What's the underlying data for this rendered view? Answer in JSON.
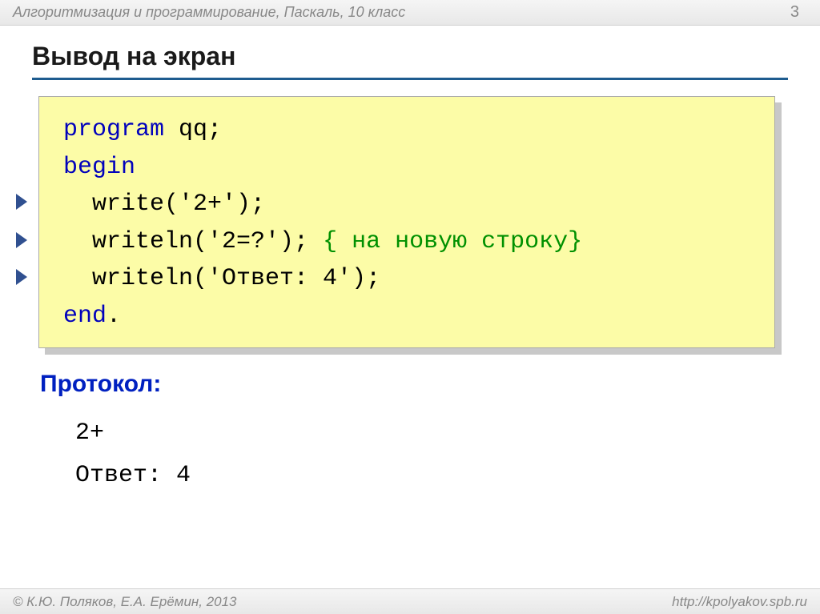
{
  "header": {
    "title": "Алгоритмизация и программирование, Паскаль, 10 класс",
    "page_number": "3"
  },
  "slide": {
    "title": "Вывод на экран"
  },
  "code": {
    "line1_keyword": "program",
    "line1_rest": " qq;",
    "line2_keyword": "begin",
    "line3_pre": "  write(",
    "line3_str": "'2+'",
    "line3_post": ");",
    "line4_pre": "  writeln(",
    "line4_str": "'2=?'",
    "line4_post": "); ",
    "line4_comment": "{ на новую строку}",
    "line5_pre": "  writeln(",
    "line5_str": "'Ответ: 4'",
    "line5_post": ");",
    "line6_keyword": "end",
    "line6_rest": "."
  },
  "protocol": {
    "label": "Протокол:",
    "output1": "2+",
    "output2": "Ответ: 4"
  },
  "footer": {
    "left": "© К.Ю. Поляков, Е.А. Ерёмин, 2013",
    "right": "http://kpolyakov.spb.ru"
  }
}
